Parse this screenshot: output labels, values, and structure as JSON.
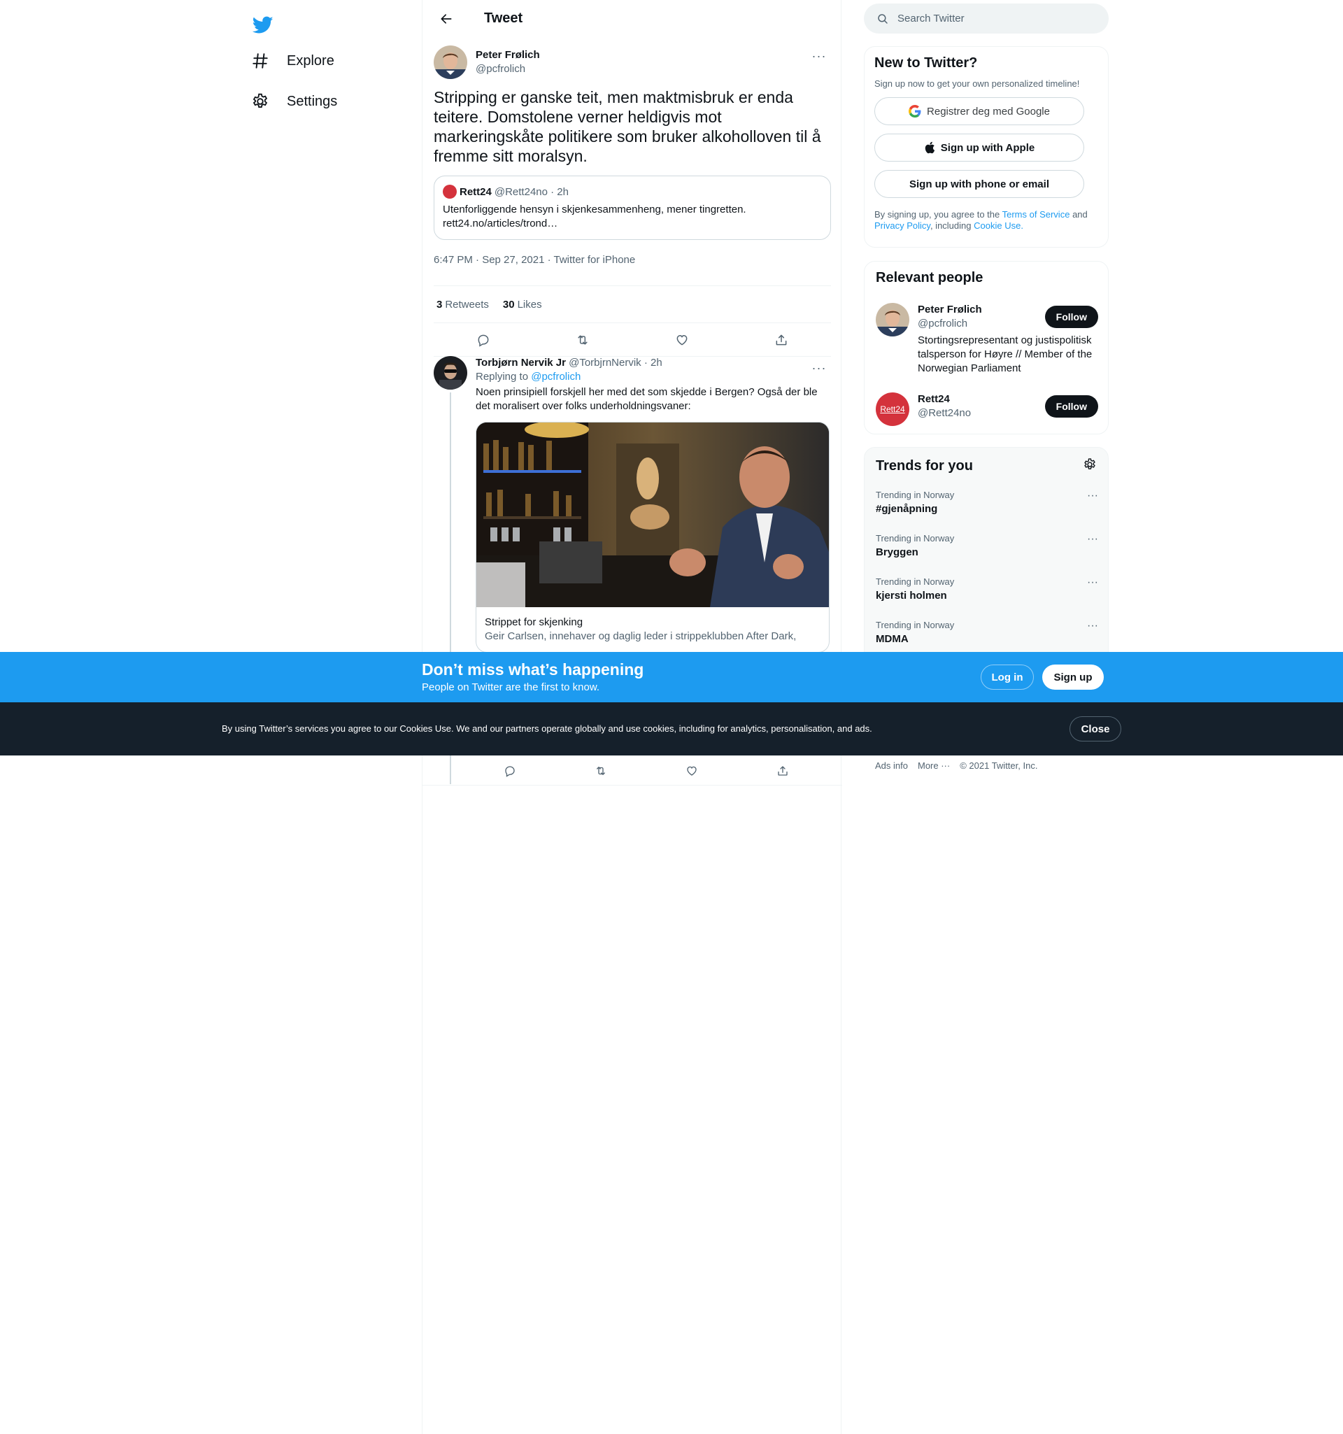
{
  "colors": {
    "brand": "#1d9bf0",
    "text": "#0f1419",
    "muted": "#536471",
    "border": "#eff3f4",
    "dark_bar": "#15202b"
  },
  "nav": {
    "logo_icon": "twitter-bird-icon",
    "items": [
      {
        "label": "Explore",
        "icon": "hashtag-icon"
      },
      {
        "label": "Settings",
        "icon": "gear-icon"
      }
    ]
  },
  "main": {
    "title": "Tweet",
    "tweet": {
      "author_name": "Peter Frølich",
      "author_handle": "@pcfrolich",
      "text": "Stripping er ganske teit, men maktmisbruk er enda teitere. Domstolene verner heldigvis mot markeringskåte politikere som bruker alkoholloven til å fremme sitt moralsyn.",
      "quote": {
        "name": "Rett24",
        "handle_time": "@Rett24no · 2h",
        "text": "Utenforliggende hensyn i skjenkesammenheng, mener tingretten. rett24.no/articles/trond…"
      },
      "timestamp": "6:47 PM · Sep 27, 2021 · Twitter for iPhone",
      "retweets_count": "3",
      "retweets_label": "Retweets",
      "likes_count": "30",
      "likes_label": "Likes"
    },
    "reply": {
      "name": "Torbjørn Nervik Jr",
      "handle_time": "@TorbjrnNervik · 2h",
      "replying_prefix": "Replying to",
      "replying_to": "@pcfrolich",
      "text": "Noen prinsipiell forskjell her med det som skjedde i Bergen? Også der ble det moralisert over folks underholdningsvaner:",
      "card_title": "Strippet for skjenking",
      "card_desc": "Geir Carlsen, innehaver og daglig leder i strippeklubben After Dark,"
    }
  },
  "sidebar": {
    "search_placeholder": "Search Twitter",
    "new_to_twitter": {
      "title": "New to Twitter?",
      "subtitle": "Sign up now to get your own personalized timeline!",
      "google": "Registrer deg med Google",
      "apple": "Sign up with Apple",
      "phone": "Sign up with phone or email",
      "legal_1": "By signing up, you agree to the",
      "terms": "Terms of Service",
      "legal_2": "and",
      "privacy": "Privacy Policy",
      "legal_3": ", including",
      "cookie": "Cookie Use."
    },
    "relevant_people": {
      "title": "Relevant people",
      "people": [
        {
          "name": "Peter Frølich",
          "handle": "@pcfrolich",
          "bio": "Stortingsrepresentant og justispolitisk talsperson for Høyre // Member of the Norwegian Parliament",
          "button": "Follow"
        },
        {
          "name": "Rett24",
          "handle": "@Rett24no",
          "bio": "",
          "button": "Follow",
          "avatar_text": "Rett24"
        }
      ]
    },
    "trends": {
      "title": "Trends for you",
      "items": [
        {
          "context": "Trending in Norway",
          "name": "#gjenåpning"
        },
        {
          "context": "Trending in Norway",
          "name": "Bryggen"
        },
        {
          "context": "Trending in Norway",
          "name": "kjersti holmen"
        },
        {
          "context": "Trending in Norway",
          "name": "MDMA"
        }
      ]
    },
    "footer": {
      "ads": "Ads info",
      "more": "More ···",
      "copyright": "© 2021 Twitter, Inc."
    }
  },
  "signup_bar": {
    "title": "Don’t miss what’s happening",
    "subtitle": "People on Twitter are the first to know.",
    "login": "Log in",
    "signup": "Sign up"
  },
  "cookie_bar": {
    "text": "By using Twitter’s services you agree to our Cookies Use. We and our partners operate globally and use cookies, including for analytics, personalisation, and ads.",
    "close": "Close"
  }
}
